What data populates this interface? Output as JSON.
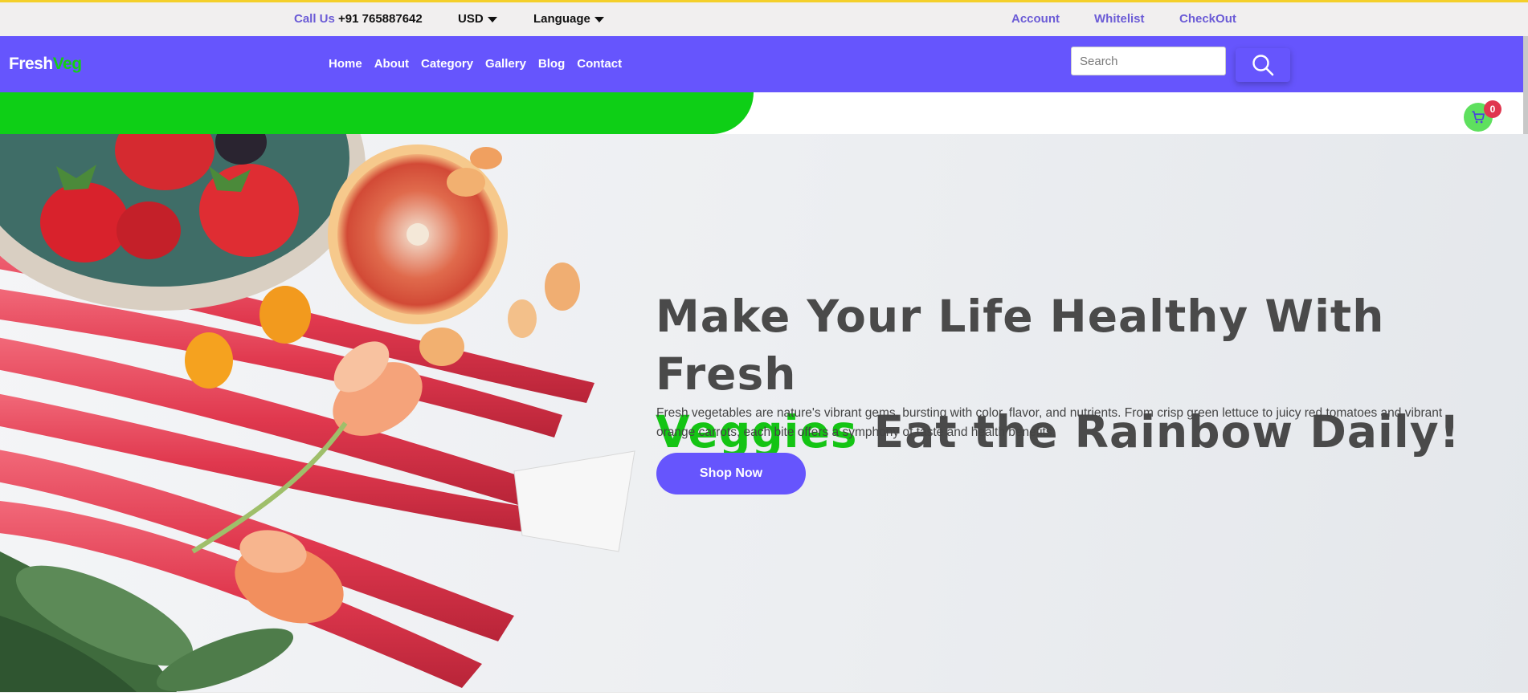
{
  "topbar": {
    "call_label": "Call Us",
    "call_number": "+91 765887642",
    "currency": "USD",
    "language": "Language",
    "account": "Account",
    "whitelist": "Whitelist",
    "checkout": "CheckOut"
  },
  "navbar": {
    "logo_part1": "Fresh",
    "logo_part2": "Veg",
    "menu": [
      "Home",
      "About",
      "Category",
      "Gallery",
      "Blog",
      "Contact"
    ],
    "search_placeholder": "Search",
    "search_icon": "search-icon"
  },
  "cart": {
    "icon": "cart-icon",
    "count": "0"
  },
  "hero": {
    "headline_line1": "Make Your Life Healthy With Fresh",
    "headline_green": "Veggies",
    "headline_rest": " Eat the Rainbow Daily!",
    "description": "Fresh vegetables are nature's vibrant gems, bursting with color, flavor, and nutrients. From crisp green lettuce to juicy red tomatoes and vibrant orange carrots, each bite offers a symphony of taste and health benefits.",
    "button": "Shop Now"
  },
  "colors": {
    "brand_purple": "#6655fd",
    "brand_green": "#0ecf16",
    "badge_red": "#e0364f",
    "topbar_border": "#f4cf2a"
  }
}
